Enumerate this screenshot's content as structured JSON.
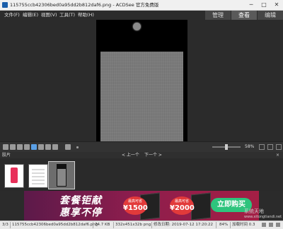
{
  "window": {
    "title": "115755ccb42306bed0a95dd2b812daf6.png - ACDSee 官方免费版",
    "minimize_glyph": "─",
    "maximize_glyph": "□",
    "close_glyph": "✕"
  },
  "menu": {
    "items": [
      "文件(F)",
      "编辑(E)",
      "视图(V)",
      "工具(T)",
      "帮助(H)"
    ]
  },
  "mode_tabs": {
    "manage": "管理",
    "view": "查看",
    "edit": "编辑",
    "active": "view"
  },
  "toolbar": {
    "zoom_label": "58%"
  },
  "filmstrip": {
    "label": "胶片",
    "prev_label": "< 上一个",
    "next_label": "下一个 >",
    "close_glyph": "×"
  },
  "ad": {
    "headline1": "套餐钜献",
    "headline2": "惠享不停",
    "badge1_top": "最高可省",
    "badge1_value": "¥1500",
    "badge2_top": "最高可省",
    "badge2_value": "¥2000",
    "buy_button": "立即购买"
  },
  "status": {
    "index": "3/3",
    "filename": "115755ccb42306bed0a95dd2b812daf6.png",
    "filesize": "74.7 KB",
    "dimensions": "332x451x32b png",
    "modified": "修改日期: 2019-07-12 17:20:22",
    "zoom": "84%",
    "load_time": "加载时间 0.3"
  },
  "watermark": {
    "text": "系统天地",
    "url": "www.xitongtiandi.net"
  },
  "colors": {
    "ad_button": "#2ec47d",
    "active_thumb_border": "#cfcfcf",
    "badge": "#e23a3a"
  }
}
